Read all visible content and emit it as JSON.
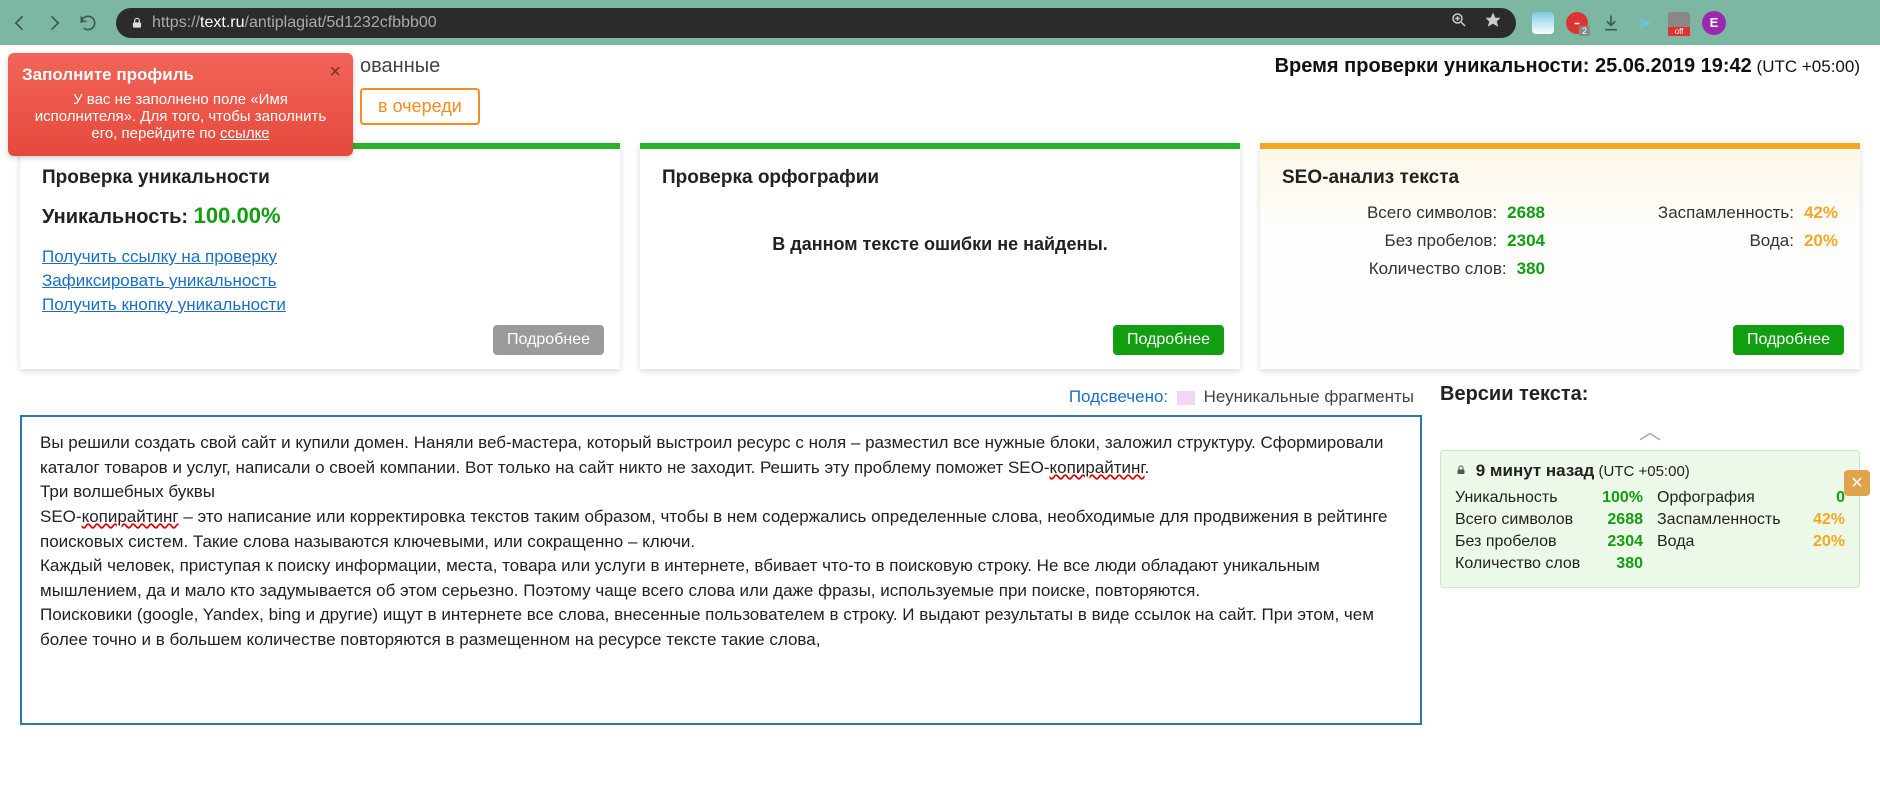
{
  "url_prefix": "https://",
  "url_domain": "text.ru",
  "url_path": "/antiplagiat/5d1232cfbbb00",
  "avatar_letter": "E",
  "ext_count": "2",
  "alert": {
    "title": "Заполните профиль",
    "body_prefix": "У вас не заполнено поле «Имя исполнителя». Для того, чтобы заполнить его, перейдите по ",
    "link_word": "ссылке"
  },
  "visible_word": "ованные",
  "timecheck_label": "Время проверки уникальности: ",
  "timecheck_value": "25.06.2019 19:42",
  "timecheck_utc": " (UTC +05:00)",
  "queue_btn": "в очереди",
  "card_uniq": {
    "title": "Проверка уникальности",
    "label": "Уникальность: ",
    "value": "100.00%",
    "link1": "Получить ссылку на проверку",
    "link2": "Зафиксировать уникальность",
    "link3": "Получить кнопку уникальности",
    "more": "Подробнее"
  },
  "card_spell": {
    "title": "Проверка орфографии",
    "message": "В данном тексте ошибки не найдены.",
    "more": "Подробнее"
  },
  "card_seo": {
    "title": "SEO-анализ текста",
    "rows_left": [
      {
        "label": "Всего символов:",
        "value": "2688",
        "cls": "green-v"
      },
      {
        "label": "Без пробелов:",
        "value": "2304",
        "cls": "green-v"
      },
      {
        "label": "Количество слов:",
        "value": "380",
        "cls": "green-v"
      }
    ],
    "rows_right": [
      {
        "label": "Заспамленность:",
        "value": "42%",
        "cls": "orange-v"
      },
      {
        "label": "Вода:",
        "value": "20%",
        "cls": "orange-v"
      }
    ],
    "more": "Подробнее"
  },
  "legend_label": "Подсвечено:",
  "legend_text": "Неуникальные фрагменты",
  "maintext_p1a": "Вы решили создать свой сайт и купили домен. Наняли веб-мастера, который выстроил ресурс с ноля – разместил все нужные блоки, заложил структуру. Сформировали каталог товаров и услуг, написали о своей компании. Вот только на сайт никто не заходит. Решить эту проблему поможет SEO-",
  "maintext_p1_red": "копирайтинг",
  "maintext_p1b": ".",
  "maintext_p2": "Три волшебных буквы",
  "maintext_p3a": "SEO-",
  "maintext_p3_red": "копирайтинг",
  "maintext_p3b": " – это написание или корректировка текстов таким образом, чтобы в нем содержались определенные слова, необходимые для продвижения в рейтинге поисковых систем. Такие слова называются ключевыми, или сокращенно – ключи.",
  "maintext_p4": "Каждый человек, приступая к поиску информации, места, товара или услуги в интернете, вбивает что-то в поисковую строку. Не все люди обладают уникальным мышлением, да и мало кто задумывается об этом серьезно. Поэтому чаще всего слова или даже фразы, используемые при поиске, повторяются.",
  "maintext_p5": "Поисковики (google, Yandex, bing и другие) ищут в интернете все слова, внесенные пользователем в строку. И выдают результаты в виде ссылок на сайт. При этом, чем более точно и в большем количестве повторяются в размещенном на ресурсе тексте такие слова,",
  "versions_title": "Версии текста:",
  "version": {
    "head_time": "9 минут назад",
    "head_utc": " (UTC +05:00)",
    "rows_left": [
      {
        "label": "Уникальность",
        "value": "100%",
        "cls": "green-v"
      },
      {
        "label": "Всего символов",
        "value": "2688",
        "cls": "green-v"
      },
      {
        "label": "Без пробелов",
        "value": "2304",
        "cls": "green-v"
      },
      {
        "label": "Количество слов",
        "value": "380",
        "cls": "green-v"
      }
    ],
    "rows_right": [
      {
        "label": "Орфография",
        "value": "0",
        "cls": "green-v"
      },
      {
        "label": "Заспамленность",
        "value": "42%",
        "cls": "orange-v"
      },
      {
        "label": "Вода",
        "value": "20%",
        "cls": "orange-v"
      }
    ]
  }
}
